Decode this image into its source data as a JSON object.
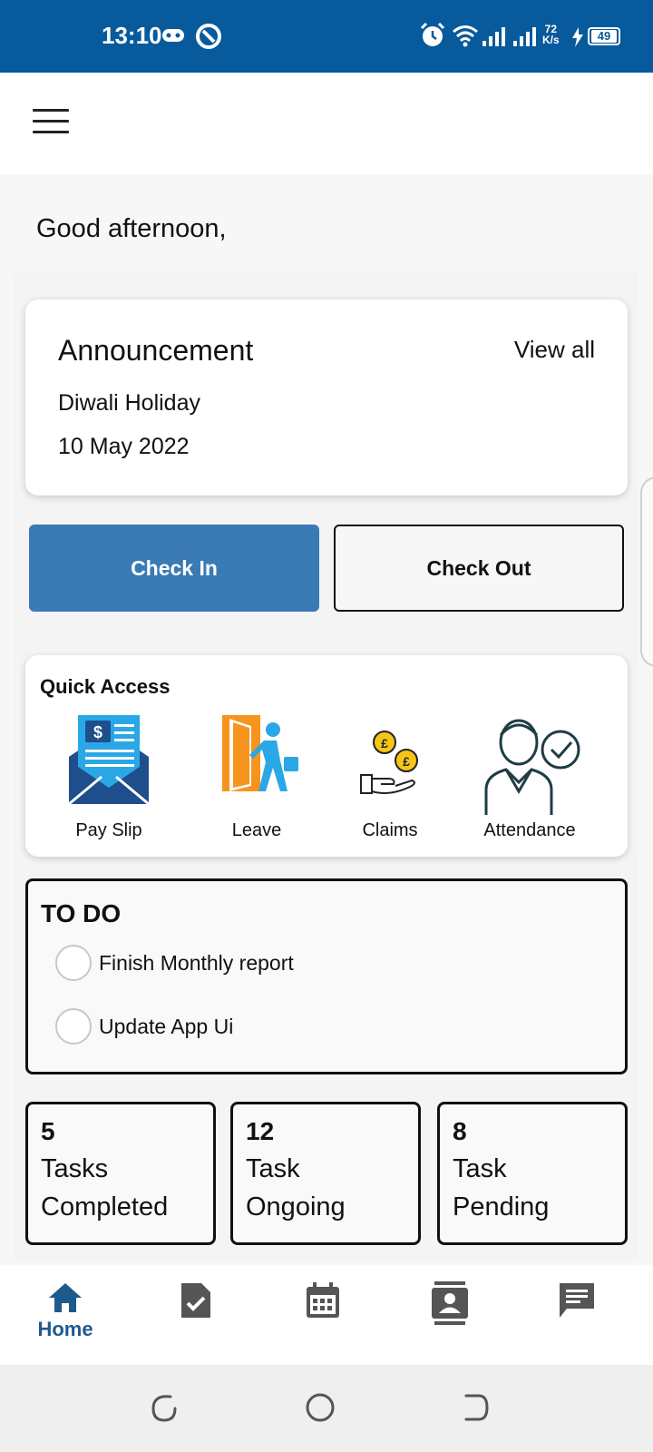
{
  "status_bar": {
    "time": "13:10",
    "net_speed_value": "72",
    "net_speed_unit": "K/s",
    "battery": "49"
  },
  "greeting": "Good afternoon,",
  "announcement": {
    "title": "Announcement",
    "view_all": "View all",
    "item": "Diwali Holiday",
    "date": "10 May 2022"
  },
  "attendance": {
    "check_in": "Check In",
    "check_out": "Check Out"
  },
  "quick_access": {
    "title": "Quick Access",
    "items": [
      {
        "label": "Pay Slip",
        "icon": "payslip-icon"
      },
      {
        "label": "Leave",
        "icon": "leave-icon"
      },
      {
        "label": "Claims",
        "icon": "claims-icon"
      },
      {
        "label": "Attendance",
        "icon": "attendance-icon"
      }
    ]
  },
  "todo": {
    "title": "TO DO",
    "items": [
      {
        "text": "Finish Monthly report"
      },
      {
        "text": "Update App Ui"
      }
    ]
  },
  "stats": [
    {
      "value": "5",
      "label": "Tasks\nCompleted"
    },
    {
      "value": "12",
      "label": "Task\nOngoing"
    },
    {
      "value": "8",
      "label": "Task\nPending"
    }
  ],
  "bottom_nav": {
    "items": [
      {
        "label": "Home",
        "icon": "home-icon"
      },
      {
        "label": "",
        "icon": "task-icon"
      },
      {
        "label": "",
        "icon": "calendar-icon"
      },
      {
        "label": "",
        "icon": "contact-icon"
      },
      {
        "label": "",
        "icon": "chat-icon"
      }
    ]
  },
  "colors": {
    "status_bar": "#075a9c",
    "primary_button": "#3a7ab5",
    "nav_active": "#1f5a8c"
  }
}
